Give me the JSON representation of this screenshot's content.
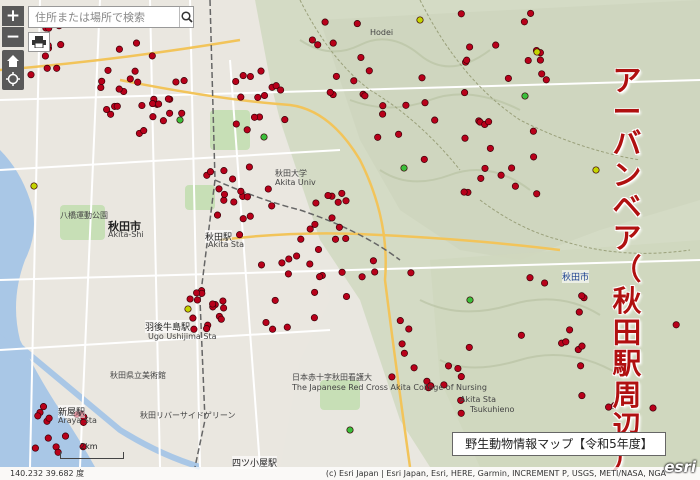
{
  "map": {
    "title": "野生動物情報マップ【令和5年度】",
    "banner_chars": [
      "ア",
      "ー",
      "バ",
      "ン",
      "ベ",
      "ア",
      "（",
      "秋",
      "田",
      "駅",
      "周",
      "辺",
      "）"
    ],
    "search": {
      "placeholder": "住所または場所で検索",
      "value": ""
    },
    "controls": {
      "zoom_in": "+",
      "zoom_out": "−"
    },
    "coordinates": "140.232 39.682 度",
    "scale_label": "2km",
    "attribution": "(c) Esri Japan | Esri Japan, Esri, HERE, Garmin, INCREMENT P, USGS, METI/NASA, NGA",
    "logo": "esri",
    "colors": {
      "sighting": "#b8001a",
      "alt_sighting": "#c4d400",
      "green_point": "#3bbf3b",
      "terrain": "#d5dcc6",
      "urban": "#e9e7e0"
    },
    "labels": [
      {
        "text": "秋田市",
        "cls": "big"
      },
      {
        "text": "Akita-Shi",
        "cls": ""
      },
      {
        "text": "秋田駅",
        "cls": "station"
      },
      {
        "text": "Akita Sta",
        "cls": ""
      },
      {
        "text": "羽後牛島駅",
        "cls": "station"
      },
      {
        "text": "Ugo Ushijima Sta",
        "cls": ""
      },
      {
        "text": "新屋駅",
        "cls": "station"
      },
      {
        "text": "Araya Sta",
        "cls": ""
      },
      {
        "text": "四ツ小屋駅",
        "cls": "station"
      },
      {
        "text": "秋田市",
        "cls": "city-blue"
      },
      {
        "text": "八橋運動公園",
        "cls": ""
      },
      {
        "text": "秋田大学",
        "cls": ""
      },
      {
        "text": "Akita Univ",
        "cls": ""
      },
      {
        "text": "秋田県立美術館",
        "cls": ""
      },
      {
        "text": "秋田リバーサイドゲリーン",
        "cls": ""
      },
      {
        "text": "日本赤十字秋田看護大",
        "cls": ""
      },
      {
        "text": "The Japanese Red Cross Akita College of Nursing",
        "cls": ""
      },
      {
        "text": "Akita Sta",
        "cls": ""
      },
      {
        "text": "Tsukuhieno",
        "cls": ""
      },
      {
        "text": "Hodei",
        "cls": ""
      }
    ],
    "sightings": {
      "red_count": 260,
      "yellow_count": 5,
      "green_count": 6
    }
  }
}
